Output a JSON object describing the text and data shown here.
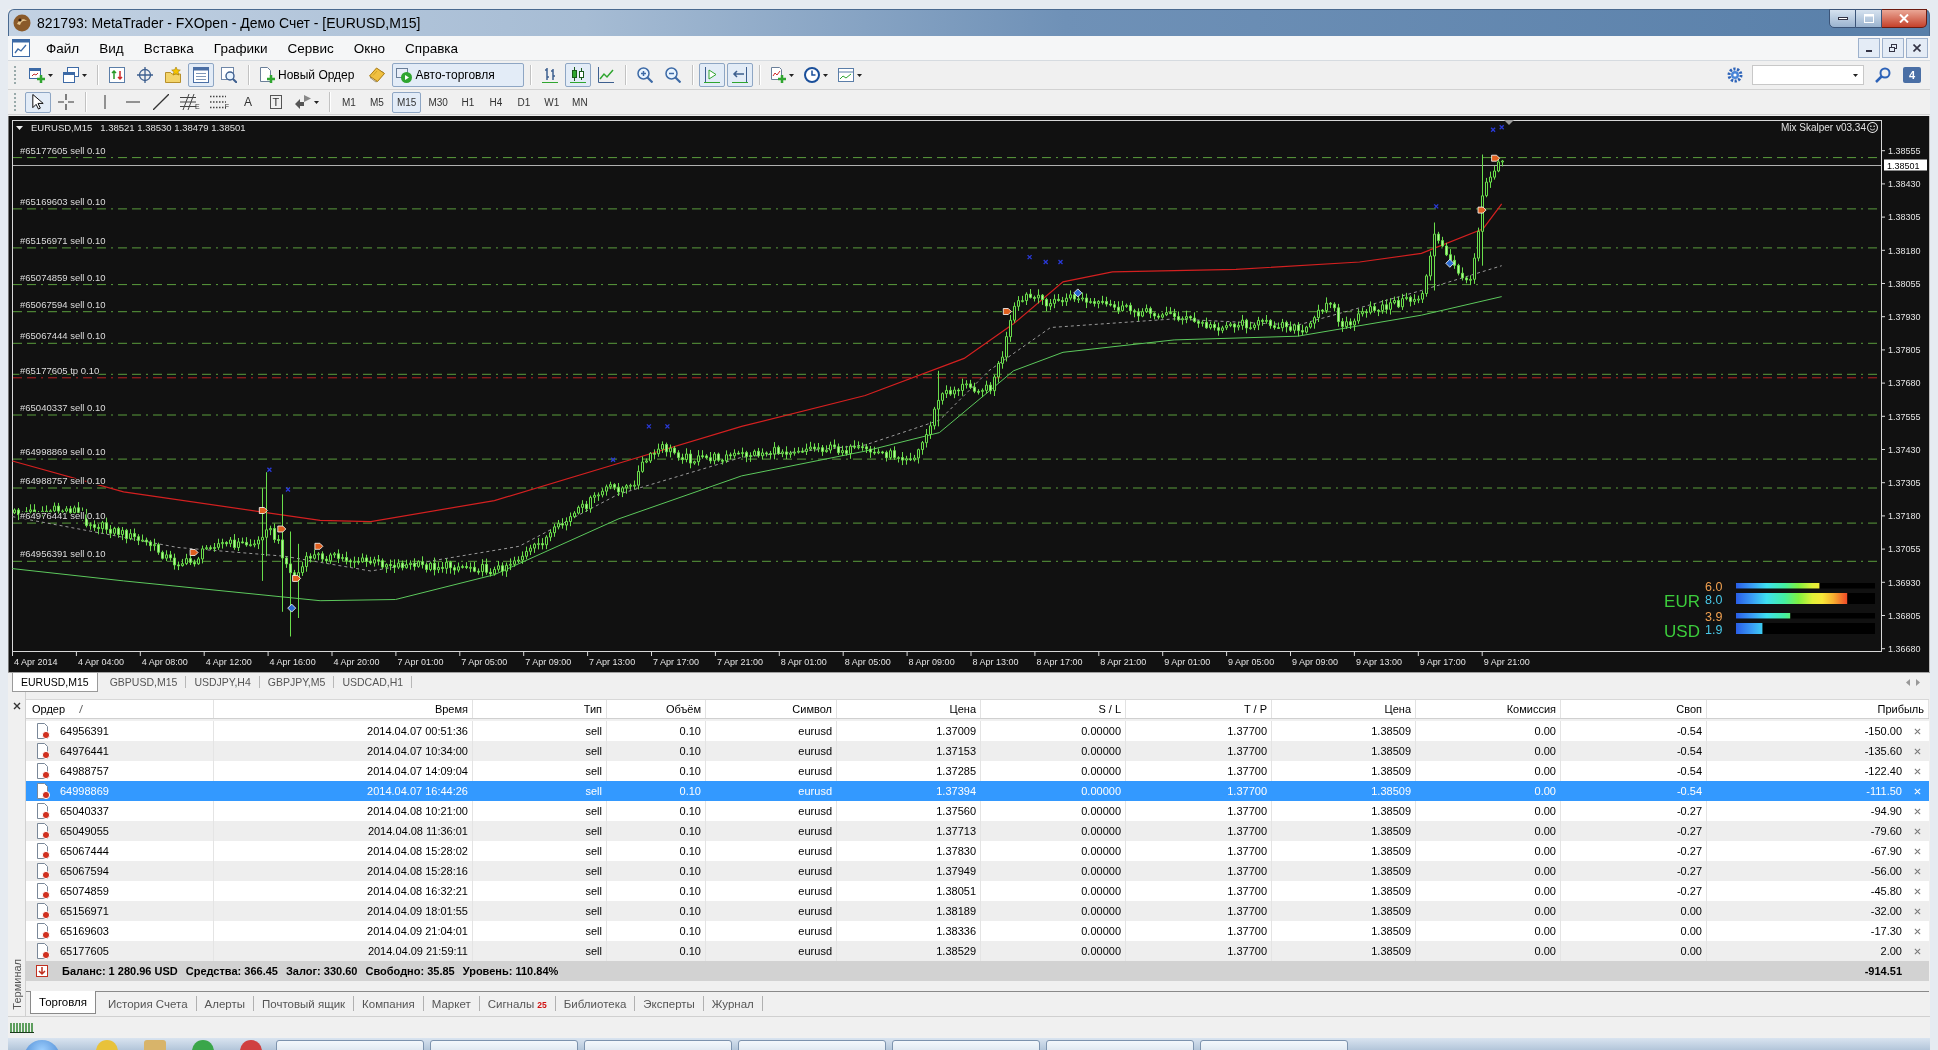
{
  "window": {
    "title": "821793: MetaTrader - FXOpen - Демо Счет - [EURUSD,M15]"
  },
  "menu": [
    "Файл",
    "Вид",
    "Вставка",
    "Графики",
    "Сервис",
    "Окно",
    "Справка"
  ],
  "standard_toolbar": [
    [
      {
        "kind": "new-chart",
        "pressed": false
      },
      {
        "kind": "profiles",
        "pressed": false
      }
    ],
    [
      {
        "kind": "market-watch",
        "pressed": false
      },
      {
        "kind": "data-window",
        "pressed": false
      },
      {
        "kind": "navigator",
        "pressed": false
      },
      {
        "kind": "terminal",
        "pressed": true
      },
      {
        "kind": "tester",
        "pressed": false
      }
    ],
    [
      {
        "kind": "new-order",
        "label": "Новый Ордер",
        "pressed": false
      },
      {
        "kind": "editor",
        "pressed": false
      },
      {
        "kind": "autotrading",
        "label": "Авто-торговля",
        "pressed": true
      }
    ],
    [
      {
        "kind": "bars",
        "pressed": false
      },
      {
        "kind": "candles",
        "pressed": true
      },
      {
        "kind": "line",
        "pressed": false
      }
    ],
    [
      {
        "kind": "zoom-in",
        "pressed": false
      },
      {
        "kind": "zoom-out",
        "pressed": false
      }
    ],
    [
      {
        "kind": "chart-shift",
        "pressed": true
      },
      {
        "kind": "autoscroll",
        "pressed": true
      }
    ],
    [
      {
        "kind": "indicators",
        "pressed": false
      },
      {
        "kind": "periods",
        "pressed": false
      },
      {
        "kind": "templates",
        "pressed": false
      }
    ]
  ],
  "right_tools": {
    "messages": "4"
  },
  "drawing_toolbar": [
    [
      {
        "kind": "cursor",
        "pressed": true
      },
      {
        "kind": "crosshair",
        "pressed": false
      }
    ],
    [
      {
        "kind": "vline",
        "pressed": false
      },
      {
        "kind": "hline",
        "pressed": false
      },
      {
        "kind": "trendline",
        "pressed": false
      },
      {
        "kind": "fibo",
        "label": "E",
        "pressed": false
      },
      {
        "kind": "channel",
        "label": "F",
        "pressed": false
      },
      {
        "kind": "text",
        "label": "A",
        "pressed": false
      },
      {
        "kind": "text-label",
        "label": "T",
        "pressed": false
      },
      {
        "kind": "arrows",
        "pressed": false
      }
    ]
  ],
  "periods": [
    {
      "label": "M1",
      "selected": false
    },
    {
      "label": "M5",
      "selected": false
    },
    {
      "label": "M15",
      "selected": true
    },
    {
      "label": "M30",
      "selected": false
    },
    {
      "label": "H1",
      "selected": false
    },
    {
      "label": "H4",
      "selected": false
    },
    {
      "label": "D1",
      "selected": false
    },
    {
      "label": "W1",
      "selected": false
    },
    {
      "label": "MN",
      "selected": false
    }
  ],
  "chart": {
    "symbol": "EURUSD,M15",
    "quotes": "1.38521 1.38530 1.38479 1.38501",
    "indicator": "Mix Skalper v03.34",
    "order_lines": [
      {
        "kind": "sell",
        "label": "#65177605 sell 0.10"
      },
      {
        "kind": "sell",
        "label": "#65169603 sell 0.10"
      },
      {
        "kind": "sell",
        "label": "#65156971 sell 0.10"
      },
      {
        "kind": "sell",
        "label": "#65074859 sell 0.10"
      },
      {
        "kind": "sell",
        "label": "#65067594 sell 0.10"
      },
      {
        "kind": "sell",
        "label": "#65067444 sell 0.10"
      },
      {
        "kind": "sell"
      },
      {
        "kind": "tp",
        "label": "#65177605 tp 0.10"
      },
      {
        "kind": "sell",
        "label": "#65040337 sell 0.10"
      },
      {
        "kind": "sell",
        "label": "#64998869 sell 0.10"
      },
      {
        "kind": "sell",
        "label": "#64988757 sell 0.10"
      },
      {
        "kind": "sell",
        "label": "#64976441 sell 0.10"
      },
      {
        "kind": "sell",
        "label": "#64956391 sell 0.10"
      }
    ],
    "price_axis": [
      "1.38555",
      "1.38430",
      "1.38305",
      "1.38180",
      "1.38055",
      "1.37930",
      "1.37805",
      "1.37680",
      "1.37555",
      "1.37430",
      "1.37305",
      "1.37180",
      "1.37055",
      "1.36930",
      "1.36805",
      "1.36680"
    ],
    "current_price": "1.38501",
    "time_axis": [
      "4 Apr 2014",
      "4 Apr 04:00",
      "4 Apr 08:00",
      "4 Apr 12:00",
      "4 Apr 16:00",
      "4 Apr 20:00",
      "7 Apr 01:00",
      "7 Apr 05:00",
      "7 Apr 09:00",
      "7 Apr 13:00",
      "7 Apr 17:00",
      "7 Apr 21:00",
      "8 Apr 01:00",
      "8 Apr 05:00",
      "8 Apr 09:00",
      "8 Apr 13:00",
      "8 Apr 17:00",
      "8 Apr 21:00",
      "9 Apr 01:00",
      "9 Apr 05:00",
      "9 Apr 09:00",
      "9 Apr 13:00",
      "9 Apr 17:00",
      "9 Apr 21:00"
    ],
    "strength": [
      {
        "currency": "EUR",
        "bars": [
          {
            "reading": "6.0",
            "level": 0.6
          },
          {
            "reading": "8.0",
            "level": 0.8
          }
        ]
      },
      {
        "currency": "USD",
        "bars": [
          {
            "reading": "3.9",
            "level": 0.39
          },
          {
            "reading": "1.9",
            "level": 0.19
          }
        ]
      }
    ]
  },
  "chart_tabs": [
    {
      "label": "EURUSD,M15",
      "selected": true
    },
    {
      "label": "GBPUSD,M15",
      "selected": false
    },
    {
      "label": "USDJPY,H4",
      "selected": false
    },
    {
      "label": "GBPJPY,M5",
      "selected": false
    },
    {
      "label": "USDCAD,H1",
      "selected": false
    }
  ],
  "terminal": {
    "side_label": "Терминал",
    "columns": [
      "Ордер",
      "Время",
      "Тип",
      "Объём",
      "Символ",
      "Цена",
      "S / L",
      "T / P",
      "Цена",
      "Комиссия",
      "Своп",
      "Прибыль"
    ],
    "rows": [
      {
        "cells": [
          "64956391",
          "2014.04.07 00:51:36",
          "sell",
          "0.10",
          "eurusd",
          "1.37009",
          "0.00000",
          "1.37700",
          "1.38509",
          "0.00",
          "-0.54",
          "-150.00"
        ],
        "selected": false
      },
      {
        "cells": [
          "64976441",
          "2014.04.07 10:34:00",
          "sell",
          "0.10",
          "eurusd",
          "1.37153",
          "0.00000",
          "1.37700",
          "1.38509",
          "0.00",
          "-0.54",
          "-135.60"
        ],
        "selected": false
      },
      {
        "cells": [
          "64988757",
          "2014.04.07 14:09:04",
          "sell",
          "0.10",
          "eurusd",
          "1.37285",
          "0.00000",
          "1.37700",
          "1.38509",
          "0.00",
          "-0.54",
          "-122.40"
        ],
        "selected": false
      },
      {
        "cells": [
          "64998869",
          "2014.04.07 16:44:26",
          "sell",
          "0.10",
          "eurusd",
          "1.37394",
          "0.00000",
          "1.37700",
          "1.38509",
          "0.00",
          "-0.54",
          "-111.50"
        ],
        "selected": true
      },
      {
        "cells": [
          "65040337",
          "2014.04.08 10:21:00",
          "sell",
          "0.10",
          "eurusd",
          "1.37560",
          "0.00000",
          "1.37700",
          "1.38509",
          "0.00",
          "-0.27",
          "-94.90"
        ],
        "selected": false
      },
      {
        "cells": [
          "65049055",
          "2014.04.08 11:36:01",
          "sell",
          "0.10",
          "eurusd",
          "1.37713",
          "0.00000",
          "1.37700",
          "1.38509",
          "0.00",
          "-0.27",
          "-79.60"
        ],
        "selected": false
      },
      {
        "cells": [
          "65067444",
          "2014.04.08 15:28:02",
          "sell",
          "0.10",
          "eurusd",
          "1.37830",
          "0.00000",
          "1.37700",
          "1.38509",
          "0.00",
          "-0.27",
          "-67.90"
        ],
        "selected": false
      },
      {
        "cells": [
          "65067594",
          "2014.04.08 15:28:16",
          "sell",
          "0.10",
          "eurusd",
          "1.37949",
          "0.00000",
          "1.37700",
          "1.38509",
          "0.00",
          "-0.27",
          "-56.00"
        ],
        "selected": false
      },
      {
        "cells": [
          "65074859",
          "2014.04.08 16:32:21",
          "sell",
          "0.10",
          "eurusd",
          "1.38051",
          "0.00000",
          "1.37700",
          "1.38509",
          "0.00",
          "-0.27",
          "-45.80"
        ],
        "selected": false
      },
      {
        "cells": [
          "65156971",
          "2014.04.09 18:01:55",
          "sell",
          "0.10",
          "eurusd",
          "1.38189",
          "0.00000",
          "1.37700",
          "1.38509",
          "0.00",
          "0.00",
          "-32.00"
        ],
        "selected": false
      },
      {
        "cells": [
          "65169603",
          "2014.04.09 21:04:01",
          "sell",
          "0.10",
          "eurusd",
          "1.38336",
          "0.00000",
          "1.37700",
          "1.38509",
          "0.00",
          "0.00",
          "-17.30"
        ],
        "selected": false
      },
      {
        "cells": [
          "65177605",
          "2014.04.09 21:59:11",
          "sell",
          "0.10",
          "eurusd",
          "1.38529",
          "0.00000",
          "1.37700",
          "1.38509",
          "0.00",
          "0.00",
          "2.00"
        ],
        "selected": false
      }
    ],
    "summary": {
      "items": [
        "Баланс: 1 280.96 USD",
        "Средства: 366.45",
        "Залог: 330.60",
        "Свободно: 35.85",
        "Уровень: 110.84%"
      ],
      "profit": "-914.51"
    },
    "tabs": [
      {
        "label": "Торговля",
        "selected": true
      },
      {
        "label": "История Счета",
        "selected": false
      },
      {
        "label": "Алерты",
        "selected": false
      },
      {
        "label": "Почтовый ящик",
        "selected": false
      },
      {
        "label": "Компания",
        "selected": false
      },
      {
        "label": "Маркет",
        "selected": false
      },
      {
        "label": "Сигналы",
        "badge": "25",
        "selected": false
      },
      {
        "label": "Библиотека",
        "selected": false
      },
      {
        "label": "Эксперты",
        "selected": false
      },
      {
        "label": "Журнал",
        "selected": false
      }
    ]
  }
}
